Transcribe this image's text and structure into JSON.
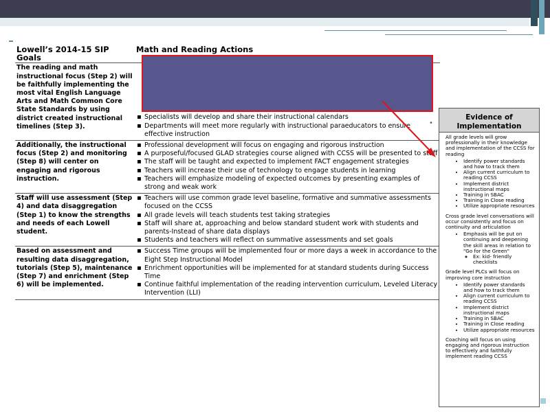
{
  "table": {
    "header_goals": "Lowell’s 2014-15 SIP Goals",
    "header_actions": "Math and Reading Actions",
    "rows": [
      {
        "goal": "The reading and math instructional focus (Step 2) will be faithfully implementing the most vital English Language Arts and Math Common Core State Standards by using district created instructional timelines (Step 3).",
        "actions": [
          "Specialists will develop and share their instructional calendars",
          "Departments will meet more regularly with instructional paraeducators to ensure effective instruction"
        ]
      },
      {
        "goal": "Additionally, the instructional focus (Step 2) and monitoring (Step 8) will center on engaging and rigorous instruction.",
        "actions": [
          "Professional development will focus on engaging and rigorous instruction",
          "A purposeful/focused GLAD strategies course aligned with CCSS will be presented to staff",
          "The staff will be taught and expected to implement FACT engagement strategies",
          "Teachers will increase their use of technology to engage students in learning",
          "Teachers will emphasize modeling of expected outcomes by presenting examples of strong and weak work"
        ]
      },
      {
        "goal": "Staff will use assessment (Step 4) and data disaggregation (Step 1) to know the strengths and needs of each Lowell student.",
        "actions": [
          "Teachers will use common grade level baseline, formative and summative assessments focused on the CCSS",
          "All grade levels will teach students test taking strategies",
          "Staff will share at, approaching and below standard student work with students and parents-Instead of share data displays",
          "Students and teachers will reflect on summative assessments and set goals"
        ]
      },
      {
        "goal": "Based on assessment and resulting data disaggregation, tutorials (Step 5), maintenance (Step 7) and enrichment (Step 6) will be implemented.",
        "actions": [
          "Success Time groups will be implemented four or more days a week in accordance to the Eight Step Instructional Model",
          "Enrichment opportunities will be implemented for at standard students during Success Time",
          "Continue faithful implementation of the reading intervention curriculum, Leveled Literacy Intervention (LLI)"
        ]
      }
    ]
  },
  "evidence": {
    "title_line1": "Evidence of",
    "title_line2": "Implementation",
    "block1_intro": "All grade levels will grow professionally in their knowledge and implementation of the CCSS for reading",
    "block1_items": [
      "Identify power standards and how to track them",
      "Align current curriculum to reading CCSS",
      "Implement district instructional maps",
      "Training in SBAC",
      "Training in Close reading",
      "Utilize appropriate resources"
    ],
    "block2_intro": "Cross grade level conversations will occur consistently and focus on continuity and articulation",
    "block2_item": "Emphasis will be put on continuing and deepening the skill areas in relation to \"Go for the Green\"",
    "block2_subitem": "Ex: kid- friendly checklists",
    "block3_intro": "Grade level PLCs will focus on improving core instruction",
    "block3_items": [
      "Identify power standards and how to track them",
      "Align current curriculum to reading CCSS",
      "Implement district instructional maps",
      "Training in SBAC",
      "Training in Close reading",
      "Utilize appropriate resources"
    ],
    "block4_intro": "Coaching will focus on using engaging and rigorous instruction to effectively and faithfully implement reading CCSS"
  },
  "colors": {
    "top_bar": "#3d3d4f",
    "highlight_fill": "#57578d",
    "highlight_border": "#e0141b",
    "arrow": "#e0141b",
    "evidence_header": "#d5d5d5"
  }
}
